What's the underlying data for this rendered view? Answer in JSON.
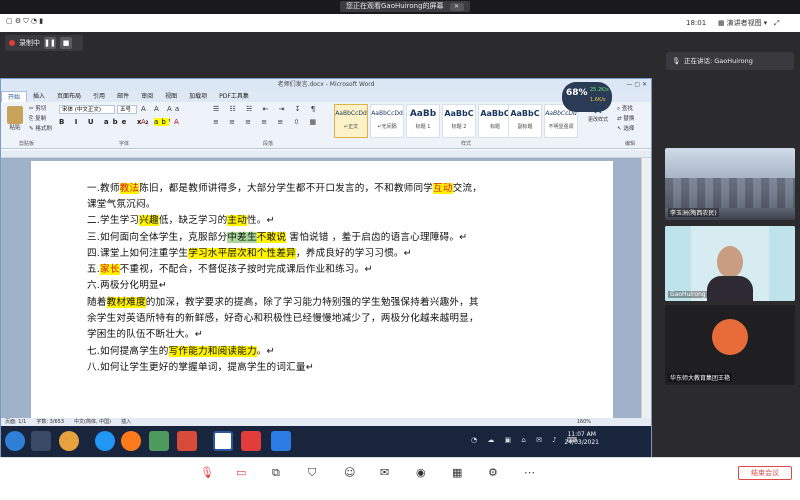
{
  "share_banner": {
    "text": "您正在观看GaoHuirong的屏幕"
  },
  "meeting_bar": {
    "time": "18:01",
    "view_label": "演讲者视图",
    "view_arrow": "▾"
  },
  "recording": {
    "label": "录制中"
  },
  "word": {
    "title": "老师们发言.docx - Microsoft Word",
    "tabs": [
      "开始",
      "插入",
      "页面布局",
      "引用",
      "邮件",
      "审阅",
      "视图",
      "加载项",
      "PDF工具集"
    ],
    "font_name": "宋体 (中文正文)",
    "font_size": "五号",
    "paste_label": "粘贴",
    "clipboard_items": [
      "剪切",
      "复制",
      "格式刷"
    ],
    "group_labels": [
      "剪贴板",
      "字体",
      "段落",
      "样式",
      "编辑"
    ],
    "styles": [
      {
        "preview": "AaBbCcDd",
        "name": "↵正文"
      },
      {
        "preview": "AaBbCcDd",
        "name": "↵无间隔"
      },
      {
        "preview": "AaBb",
        "name": "标题 1"
      },
      {
        "preview": "AaBbC",
        "name": "标题 2"
      },
      {
        "preview": "AaBbC",
        "name": "标题"
      },
      {
        "preview": "AaBbC",
        "name": "副标题"
      },
      {
        "preview": "AaBbCcDd",
        "name": "不明显强调"
      }
    ],
    "change_styles": "更改样式",
    "edit_items": [
      "查找",
      "替换",
      "选择"
    ],
    "cpu_percent": "68%",
    "net_up": "25.2K/s",
    "net_down": "1.6K/s",
    "status": {
      "page": "页面: 1/1",
      "words": "字数: 3/653",
      "lang": "中文(简体, 中国)",
      "mode": "插入",
      "zoom": "160%"
    },
    "clock_time": "11:07 AM",
    "clock_date": "24/03/2021",
    "doc_lines": [
      [
        {
          "t": "一.教师"
        },
        {
          "t": "教法",
          "hl": 1,
          "red": 1
        },
        {
          "t": "陈旧，都是教师讲得多，大部分学生都不开口发言的，不和教师同学"
        },
        {
          "t": "互动",
          "hl": 1,
          "red": 1
        },
        {
          "t": "交流，"
        }
      ],
      [
        {
          "t": "课堂气氛沉闷。"
        }
      ],
      [
        {
          "t": "二.学生学习"
        },
        {
          "t": "兴趣",
          "hl": 1
        },
        {
          "t": "低，缺乏学习的"
        },
        {
          "t": "主动",
          "hl": 1
        },
        {
          "t": "性。↵"
        }
      ],
      [
        {
          "t": "三.如何面向全体学生，克服部分"
        },
        {
          "t": "中差生",
          "hlg": 1
        },
        {
          "t": "不敢说",
          "hl": 1
        },
        {
          "t": "  害怕说错 ，羞于启齿的语言心理障碍。↵"
        }
      ],
      [
        {
          "t": "四.课堂上如何注重学生"
        },
        {
          "t": "学习水平层次和个性差异",
          "hl": 1
        },
        {
          "t": "，养成良好的学习习惯。↵"
        }
      ],
      [
        {
          "t": "五."
        },
        {
          "t": "家长",
          "hl": 1,
          "red": 1
        },
        {
          "t": "不重视，不配合，不督促孩子按时完成课后作业和练习。↵"
        }
      ],
      [
        {
          "t": "六.两极分化明显↵"
        }
      ],
      [
        {
          "t": "随着"
        },
        {
          "t": "教材难度",
          "hl": 1
        },
        {
          "t": "的加深，教学要求的提高，除了学习能力特别强的学生勉强保持着兴趣外，其"
        }
      ],
      [
        {
          "t": "余学生对英语所特有的新鲜感，好奇心和积极性已经慢慢地减少了，两极分化越来越明显，"
        }
      ],
      [
        {
          "t": "学困生的队伍不断壮大。↵"
        }
      ],
      [
        {
          "t": "七.如何提高学生的"
        },
        {
          "t": "写作能力和阅读能力",
          "hl": 1
        },
        {
          "t": "。↵"
        }
      ],
      [
        {
          "t": "八.如何让学生更好的掌握单词，提高学生的词汇量↵"
        }
      ]
    ]
  },
  "right_panel": {
    "speaking": "正在讲话: GaoHuirong",
    "videos": [
      {
        "label": "李玉洲(陶西农民)"
      },
      {
        "label": "GaoHuirong"
      },
      {
        "label": "华东师大教育集团王艳"
      }
    ]
  },
  "bottom": {
    "end_label": "结束会议"
  }
}
